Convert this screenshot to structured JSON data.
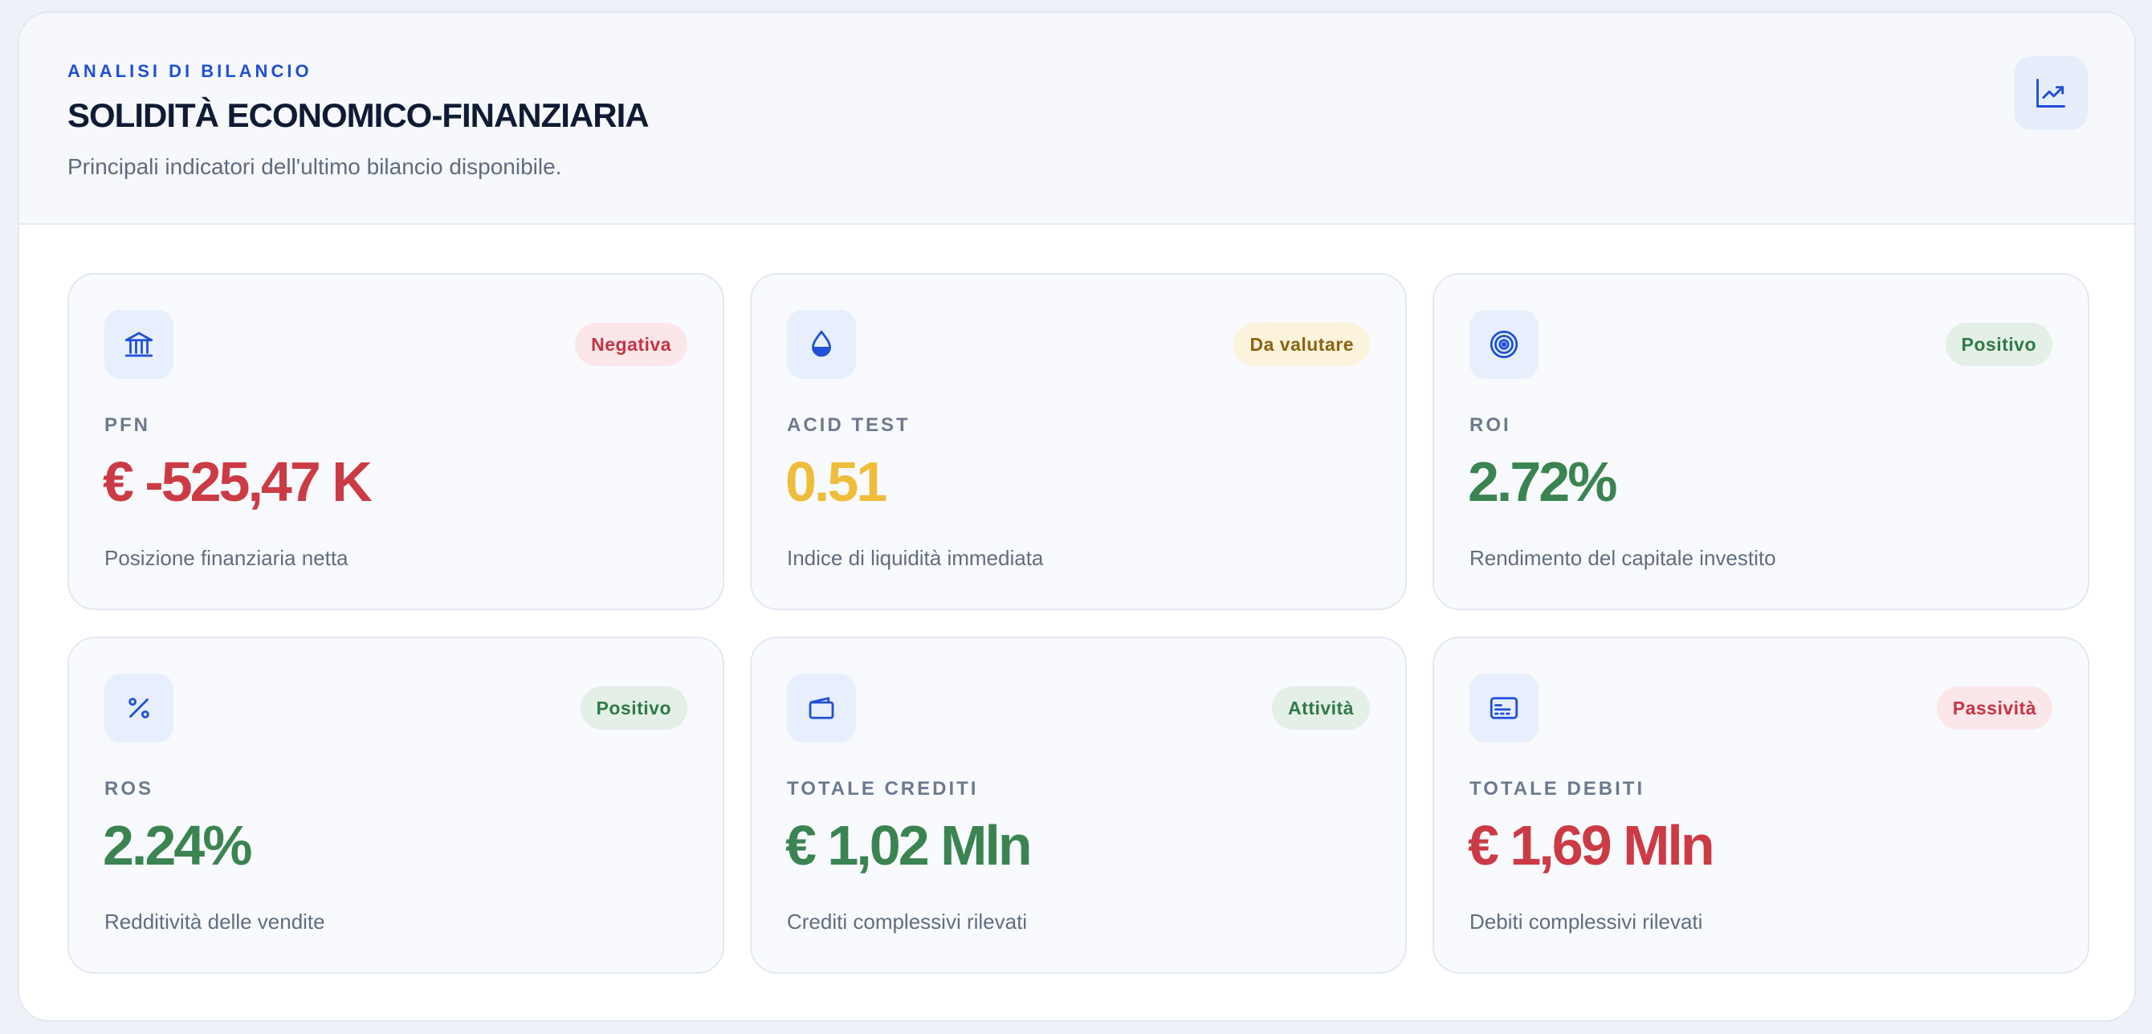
{
  "header": {
    "eyebrow": "ANALISI DI BILANCIO",
    "title": "SOLIDITÀ ECONOMICO-FINANZIARIA",
    "subtitle": "Principali indicatori dell'ultimo bilancio disponibile.",
    "icon": "chart-trend-icon"
  },
  "colors": {
    "accent": "#2150d6",
    "negative": "#cc3b45",
    "warning": "#f0bd3a",
    "positive": "#3b8452"
  },
  "cards": [
    {
      "icon": "bank-icon",
      "badge": "Negativa",
      "label": "PFN",
      "value": "€ -525,47 K",
      "desc": "Posizione finanziaria netta"
    },
    {
      "icon": "drop-icon",
      "badge": "Da valutare",
      "label": "ACID TEST",
      "value": "0.51",
      "desc": "Indice di liquidità immediata"
    },
    {
      "icon": "target-icon",
      "badge": "Positivo",
      "label": "ROI",
      "value": "2.72%",
      "desc": "Rendimento del capitale investito"
    },
    {
      "icon": "percent-icon",
      "badge": "Positivo",
      "label": "ROS",
      "value": "2.24%",
      "desc": "Redditività delle vendite"
    },
    {
      "icon": "wallet-icon",
      "badge": "Attività",
      "label": "TOTALE CREDITI",
      "value": "€ 1,02 Mln",
      "desc": "Crediti complessivi rilevati"
    },
    {
      "icon": "card-icon",
      "badge": "Passività",
      "label": "TOTALE DEBITI",
      "value": "€ 1,69 Mln",
      "desc": "Debiti complessivi rilevati"
    }
  ]
}
